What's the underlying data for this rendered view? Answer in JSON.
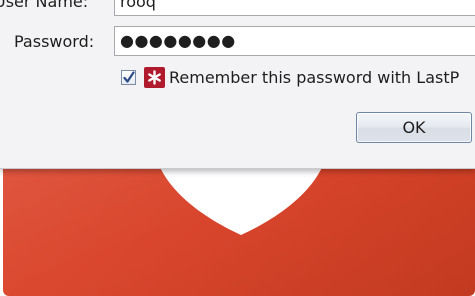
{
  "login_dialog": {
    "username_label": "User Name:",
    "username_value": "rooq",
    "password_label": "Password:",
    "password_value": "●●●●●●●●",
    "remember_checked": true,
    "remember_label": "Remember this password with LastP",
    "ok_label": "OK"
  },
  "background": {
    "panel_color": "#d8452c",
    "shield_color": "#ffffff"
  },
  "icons": {
    "checkbox": "checkmark-icon",
    "lastpass": "lastpass-asterisk-icon"
  }
}
